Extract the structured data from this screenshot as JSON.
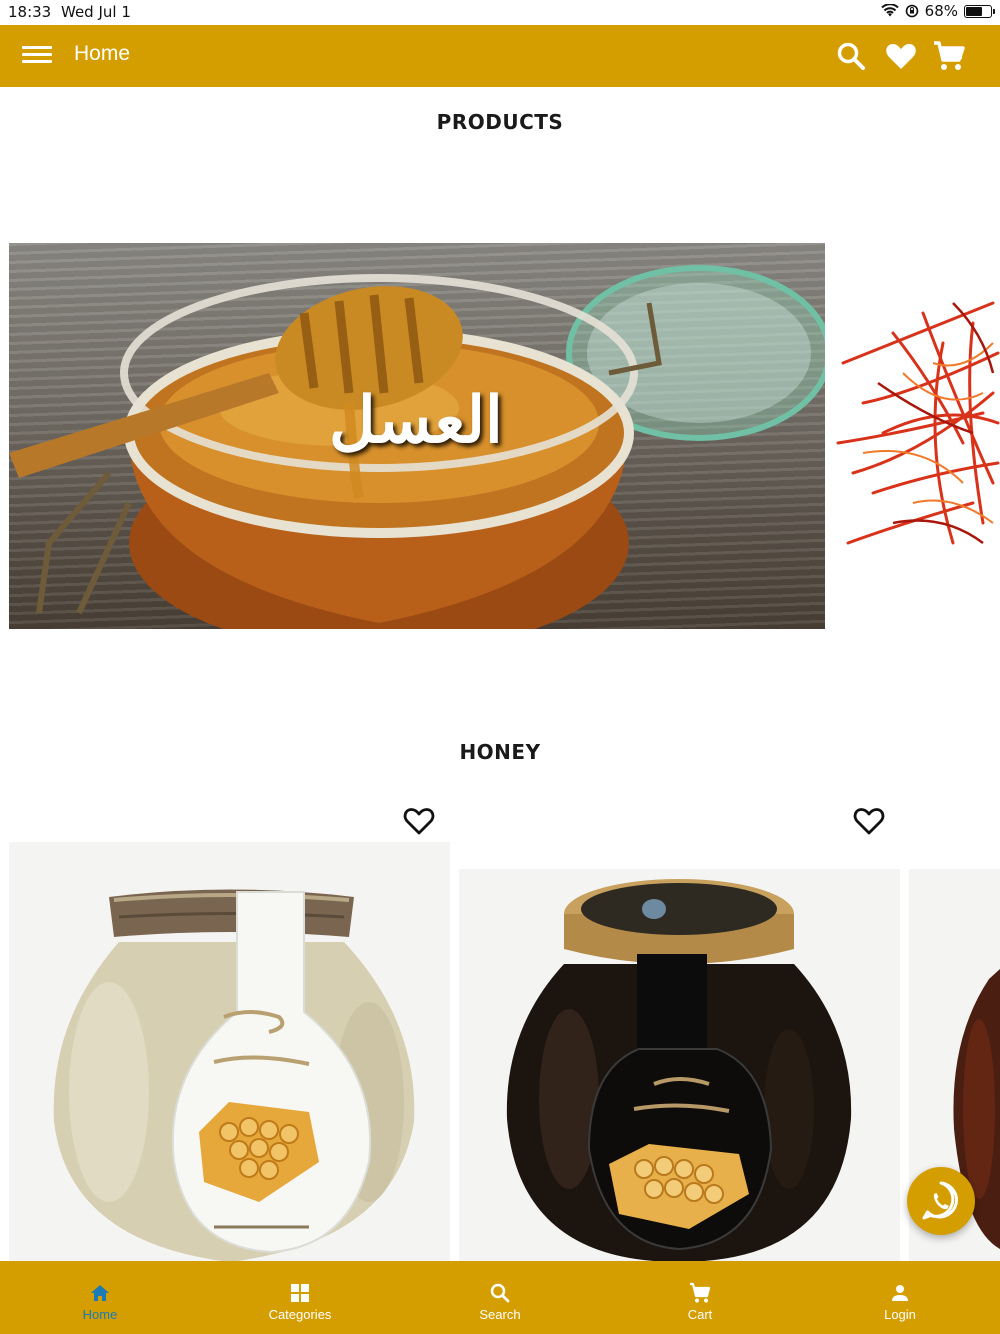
{
  "status_bar": {
    "time": "18:33",
    "date": "Wed Jul 1",
    "battery": "68%",
    "battery_level": 0.68
  },
  "app_bar": {
    "title": "Home"
  },
  "sections": {
    "products_title": "PRODUCTS",
    "honey_title": "HONEY"
  },
  "banner": {
    "overlay_text": "العسل"
  },
  "nav": {
    "items": [
      {
        "label": "Home",
        "icon": "home-icon"
      },
      {
        "label": "Categories",
        "icon": "grid-icon"
      },
      {
        "label": "Search",
        "icon": "search-icon"
      },
      {
        "label": "Cart",
        "icon": "cart-icon"
      },
      {
        "label": "Login",
        "icon": "person-icon"
      }
    ],
    "active_index": 0
  },
  "colors": {
    "primary": "#d49e00",
    "active_nav": "#1b7bb5",
    "text": "#1a1a1a"
  }
}
